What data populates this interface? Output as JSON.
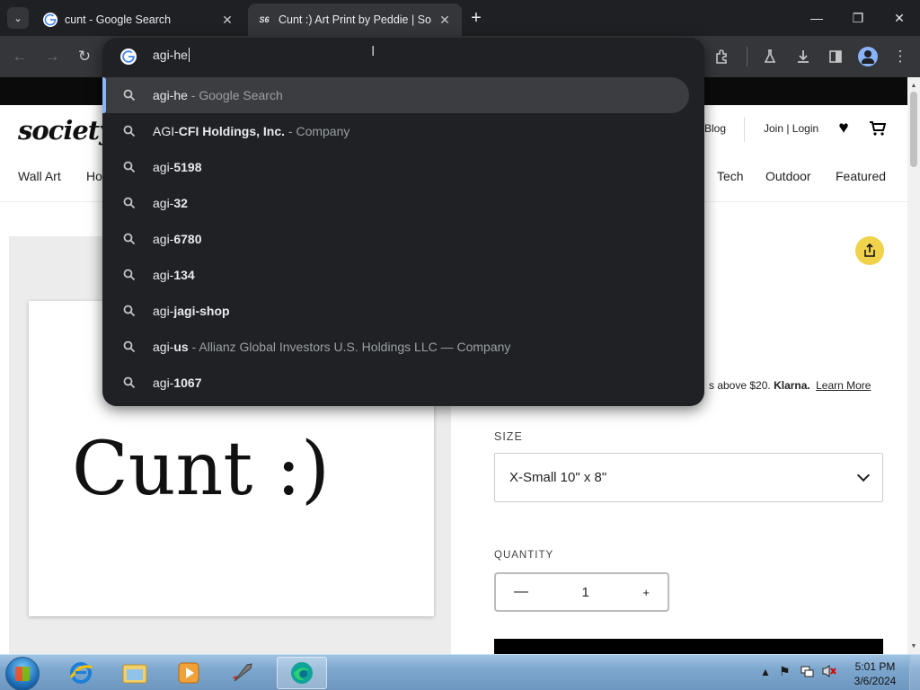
{
  "tabs": [
    {
      "title": "cunt - Google Search",
      "favicon": "google-g-icon",
      "active": false
    },
    {
      "title": "Cunt :) Art Print by Peddie | So",
      "favicon": "S6",
      "active": true
    }
  ],
  "omnibox": {
    "input": "agi-he",
    "suggestions": [
      {
        "typed": "agi-he",
        "bold": "",
        "desc": " - Google Search",
        "selected": true
      },
      {
        "typed": "AGI-",
        "bold": "CFI Holdings, Inc.",
        "desc": " - Company",
        "selected": false
      },
      {
        "typed": "agi-",
        "bold": "5198",
        "desc": "",
        "selected": false
      },
      {
        "typed": "agi-",
        "bold": "32",
        "desc": "",
        "selected": false
      },
      {
        "typed": "agi-",
        "bold": "6780",
        "desc": "",
        "selected": false
      },
      {
        "typed": "agi-",
        "bold": "134",
        "desc": "",
        "selected": false
      },
      {
        "typed": "agi-",
        "bold": "jagi-shop",
        "desc": "",
        "selected": false
      },
      {
        "typed": "agi-",
        "bold": "us",
        "desc": " - Allianz Global Investors U.S. Holdings LLC — Company",
        "selected": false
      },
      {
        "typed": "agi-",
        "bold": "1067",
        "desc": "",
        "selected": false
      }
    ]
  },
  "site": {
    "logo": "society",
    "blog": "Blog",
    "join_login": "Join | Login",
    "nav_left": [
      "Wall Art",
      "Ho"
    ],
    "nav_right": [
      "Tech",
      "Outdoor",
      "Featured"
    ],
    "artwork_text": "Cunt :)",
    "klarna_text": "s above $20.",
    "klarna_brand": "Klarna.",
    "learn_more": "Learn More",
    "size_label": "SIZE",
    "size_value": "X-Small 10\" x 8\"",
    "quantity_label": "QUANTITY",
    "quantity_minus": "—",
    "quantity_value": "1",
    "quantity_plus": "+"
  },
  "taskbar": {
    "time": "5:01 PM",
    "date": "3/6/2024"
  },
  "colors": {
    "chrome_dark": "#1f2023",
    "toolbar": "#35363a",
    "omnibox_bg": "#202124",
    "selected_row": "#3c3d40",
    "accent_blue": "#8ab4f8",
    "share_yellow": "#f0d34a"
  }
}
